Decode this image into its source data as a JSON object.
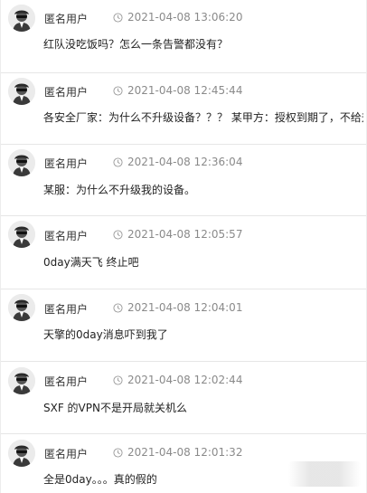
{
  "posts": [
    {
      "author": "匿名用户",
      "time": "2021-04-08 13:06:20",
      "content": "红队没吃饭吗？怎么一条告警都没有？"
    },
    {
      "author": "匿名用户",
      "time": "2021-04-08 12:45:44",
      "content": "各安全厂家：为什么不升级设备？？？ 某甲方：授权到期了，不给升级...."
    },
    {
      "author": "匿名用户",
      "time": "2021-04-08 12:36:04",
      "content": "某服：为什么不升级我的设备。"
    },
    {
      "author": "匿名用户",
      "time": "2021-04-08 12:05:57",
      "content": "0day满天飞 终止吧"
    },
    {
      "author": "匿名用户",
      "time": "2021-04-08 12:04:01",
      "content": "天擎的0day消息吓到我了"
    },
    {
      "author": "匿名用户",
      "time": "2021-04-08 12:02:44",
      "content": "SXF 的VPN不是开局就关机么"
    },
    {
      "author": "匿名用户",
      "time": "2021-04-08 12:01:32",
      "content": "全是0day。。。真的假的"
    }
  ],
  "icons": {
    "avatar": "anonymous-user-avatar-icon",
    "time": "clock-icon"
  },
  "colors": {
    "background": "#ffffff",
    "divider": "#e6e6e6",
    "time_text": "#8a8a8a",
    "content_text": "#222222"
  }
}
